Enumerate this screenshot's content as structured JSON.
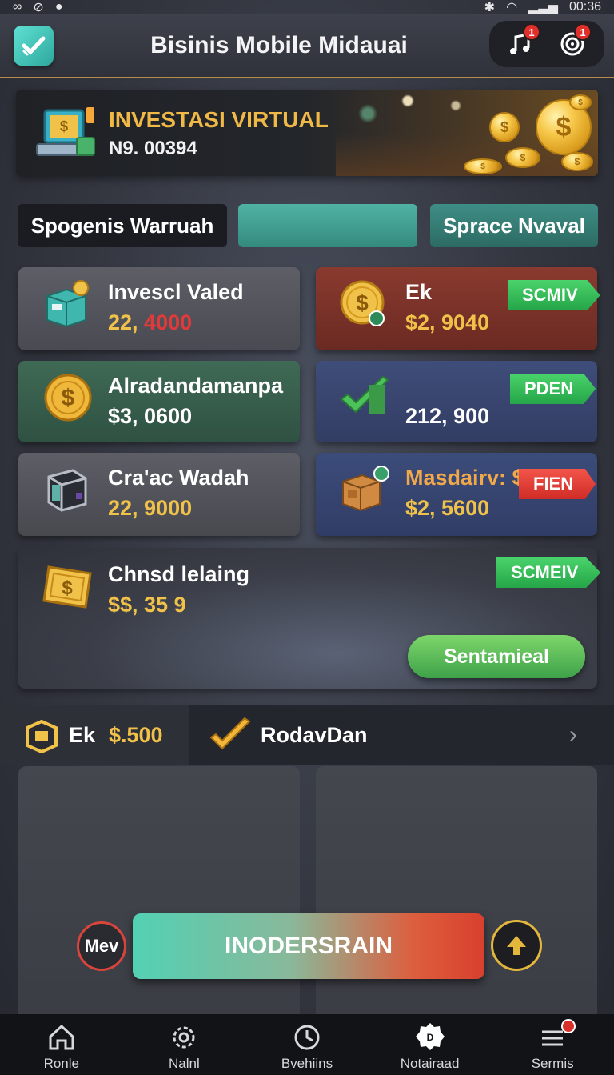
{
  "status_bar": {
    "time": "00:36"
  },
  "header": {
    "title": "Bisinis Mobile Midauai",
    "notif_count_music": "1",
    "notif_count_target": "1"
  },
  "banner": {
    "title": "INVESTASI VIRTUAL",
    "code": "N9. 00394"
  },
  "tabs": [
    {
      "label": "Spogenis Warruah"
    },
    {
      "label": ""
    },
    {
      "label": "Sprace Nvaval"
    }
  ],
  "cards": [
    {
      "name": "Invescl Valed",
      "value_prefix": "22, ",
      "value_suffix": "4000",
      "value_color": "#f0c24a",
      "suffix_color": "#e03a3a"
    },
    {
      "name": "Ek",
      "value": "$2, 9040",
      "value_color": "#f0c24a",
      "tag": "SCMIV"
    },
    {
      "name": "Alradandamanpa",
      "value": "$3, 0600",
      "value_color": "#ffffff"
    },
    {
      "name": "",
      "value": "212, 900",
      "value_color": "#ffffff",
      "tag": "PDEN"
    },
    {
      "name": "Cra'ac Wadah",
      "value": "22, 9000",
      "value_color": "#f0c24a"
    },
    {
      "name": "Masdairv: $",
      "value": "$2, 5600",
      "value_color": "#f0c24a",
      "tag": "FIEN"
    },
    {
      "name": "Chnsd lelaing",
      "value": "$$, 35 9",
      "value_color": "#f0c24a",
      "tag": "SCMEIV",
      "button": "Sentamieal"
    }
  ],
  "strip": {
    "ek_label": "Ek",
    "amount": "$.500",
    "label2": "RodavDan"
  },
  "action": {
    "left_label": "Mev",
    "main_label": "INODERSRAIN"
  },
  "nav": [
    {
      "label": "Ronle",
      "icon": "home-icon"
    },
    {
      "label": "Nalnl",
      "icon": "gear-icon"
    },
    {
      "label": "Bvehiins",
      "icon": "clock-icon"
    },
    {
      "label": "Notairaad",
      "icon": "badge-icon"
    },
    {
      "label": "Sermis",
      "icon": "menu-icon"
    }
  ],
  "colors": {
    "accent_gold": "#f0c24a",
    "accent_teal": "#4fb3a3",
    "accent_green": "#3ea24a",
    "accent_red": "#d8402e"
  }
}
